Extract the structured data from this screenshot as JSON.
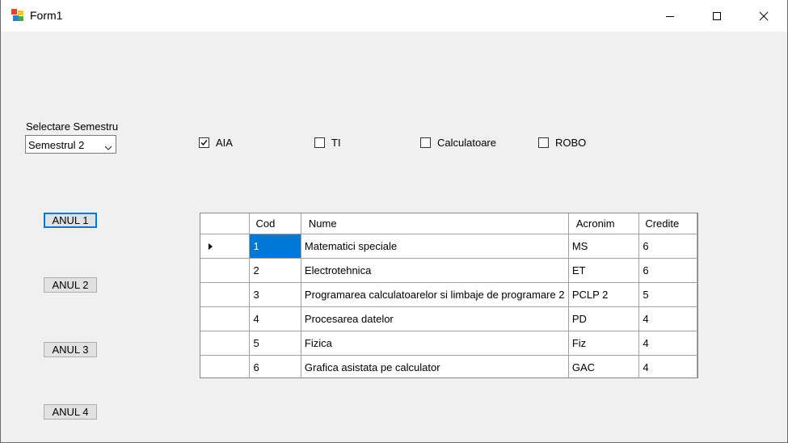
{
  "window": {
    "title": "Form1",
    "icon": "winforms-app-icon"
  },
  "controls": {
    "semester_label": "Selectare Semestru",
    "semester_combo": {
      "value": "Semestrul 2",
      "icon": "chevron-down-icon"
    }
  },
  "checkboxes": [
    {
      "label": "AIA",
      "checked": true
    },
    {
      "label": "TI",
      "checked": false
    },
    {
      "label": "Calculatoare",
      "checked": false
    },
    {
      "label": "ROBO",
      "checked": false
    }
  ],
  "year_buttons": [
    "ANUL 1",
    "ANUL 2",
    "ANUL 3",
    "ANUL 4"
  ],
  "grid": {
    "columns": [
      "Cod",
      "Nume",
      "Acronim",
      "Credite"
    ],
    "rows": [
      [
        "1",
        "Matematici speciale",
        "MS",
        "6"
      ],
      [
        "2",
        "Electrotehnica",
        "ET",
        "6"
      ],
      [
        "3",
        "Programarea calculatoarelor si limbaje de programare 2",
        "PCLP 2",
        "5"
      ],
      [
        "4",
        "Procesarea datelor",
        "PD",
        "4"
      ],
      [
        "5",
        "Fizica",
        "Fiz",
        "4"
      ],
      [
        "6",
        "Grafica asistata pe calculator",
        "GAC",
        "4"
      ]
    ],
    "selection_color": "#0078d7",
    "current_row_icon": "row-pointer-icon"
  }
}
